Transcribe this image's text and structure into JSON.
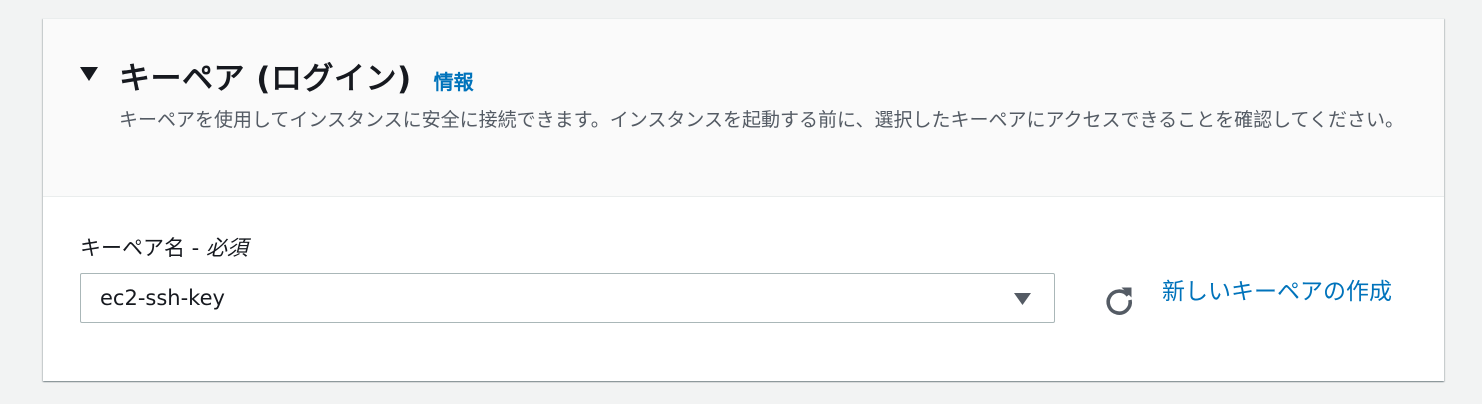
{
  "section": {
    "title": "キーペア (ログイン)",
    "info_link": "情報",
    "description": "キーペアを使用してインスタンスに安全に接続できます。インスタンスを起動する前に、選択したキーペアにアクセスできることを確認してください。",
    "collapse_icon": "caret-down-icon"
  },
  "key_pair_field": {
    "label": "キーペア名 - ",
    "required": "必須",
    "selected_value": "ec2-ssh-key",
    "dropdown_icon": "caret-down-icon",
    "refresh_icon": "refresh-icon",
    "create_link": "新しいキーペアの作成"
  },
  "colors": {
    "page_background": "#f2f3f3",
    "header_background": "#fafafa",
    "link": "#0073bb",
    "text": "#16191f",
    "secondary_text": "#545b64",
    "border": "#aab7b8"
  }
}
